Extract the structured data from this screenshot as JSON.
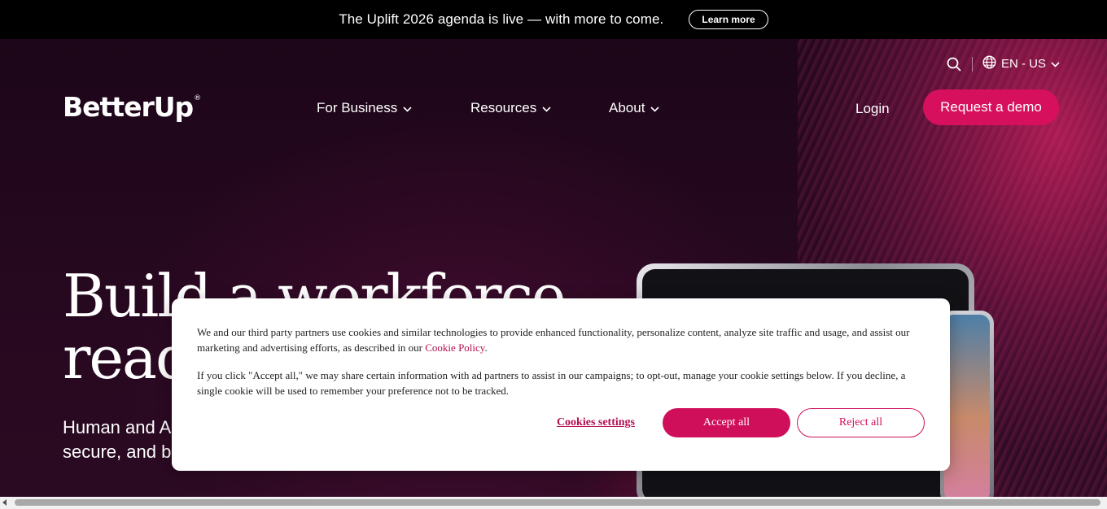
{
  "announcement": {
    "text": "The Uplift 2026 agenda is live — with more to come.",
    "button_label": "Learn more"
  },
  "utility": {
    "search_icon": "search-icon",
    "language": "EN - US"
  },
  "brand": {
    "logo_text": "BetterUp",
    "logo_mark": "®"
  },
  "nav": {
    "items": [
      {
        "label": "For Business"
      },
      {
        "label": "Resources"
      },
      {
        "label": "About"
      }
    ],
    "login": "Login",
    "demo_button": "Request a demo"
  },
  "hero": {
    "headline_line1": "Build a workforce",
    "headline_line2": "ready",
    "subhead_line1": "Human and A",
    "subhead_line2": "secure, and b"
  },
  "cookie_banner": {
    "paragraph1_before_link": "We and our third party partners use cookies and similar technologies to provide enhanced functionality, personalize content, analyze site traffic and usage, and assist our marketing and advertising efforts, as described in our ",
    "paragraph1_link": "Cookie Policy",
    "paragraph1_after_link": ".",
    "paragraph2": "If you click \"Accept all,\" we may share certain information with ad partners to assist in our campaigns; to opt-out, manage your cookie settings below. If you decline, a single cookie will be used to remember your preference not to be tracked.",
    "settings_label": "Cookies settings",
    "accept_label": "Accept all",
    "reject_label": "Reject all"
  },
  "colors": {
    "brand_accent": "#d6105c",
    "hero_bg": "#26081f"
  }
}
